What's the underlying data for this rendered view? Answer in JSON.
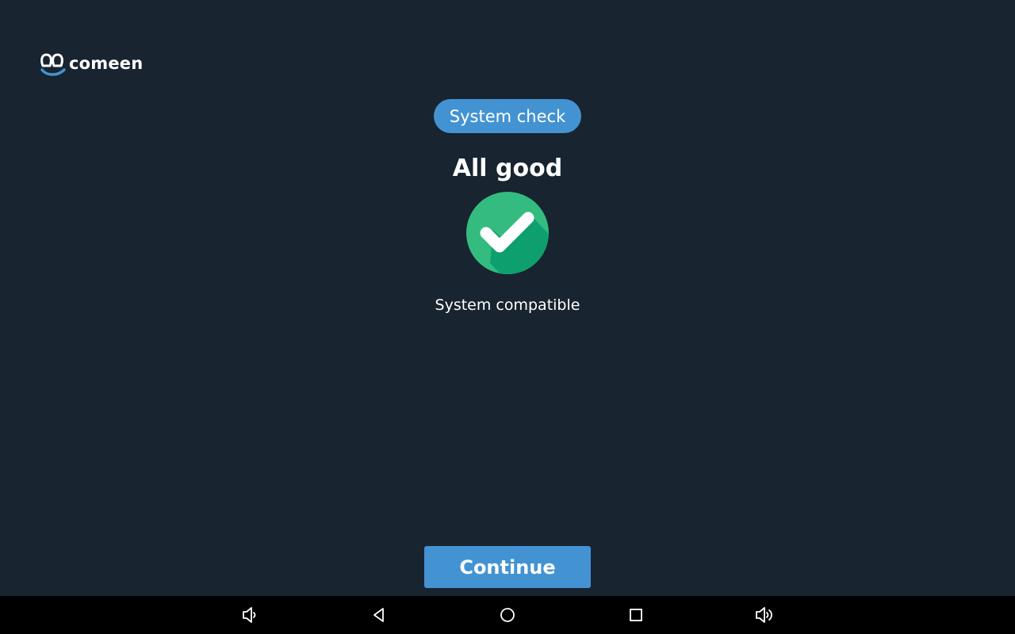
{
  "app": {
    "brand": "comeen",
    "badge": "System check",
    "title": "All good",
    "subtitle": "System compatible",
    "continue_label": "Continue"
  },
  "colors": {
    "background": "#182430",
    "accent": "#4393d3",
    "success": "#34bc80",
    "success_shadow": "#0da06e",
    "navbar": "#000000"
  },
  "icons": {
    "logo": "comeen-logo-icon",
    "status": "checkmark-circle-icon",
    "nav": [
      "volume-down-icon",
      "back-icon",
      "home-icon",
      "recents-icon",
      "volume-up-icon"
    ]
  }
}
